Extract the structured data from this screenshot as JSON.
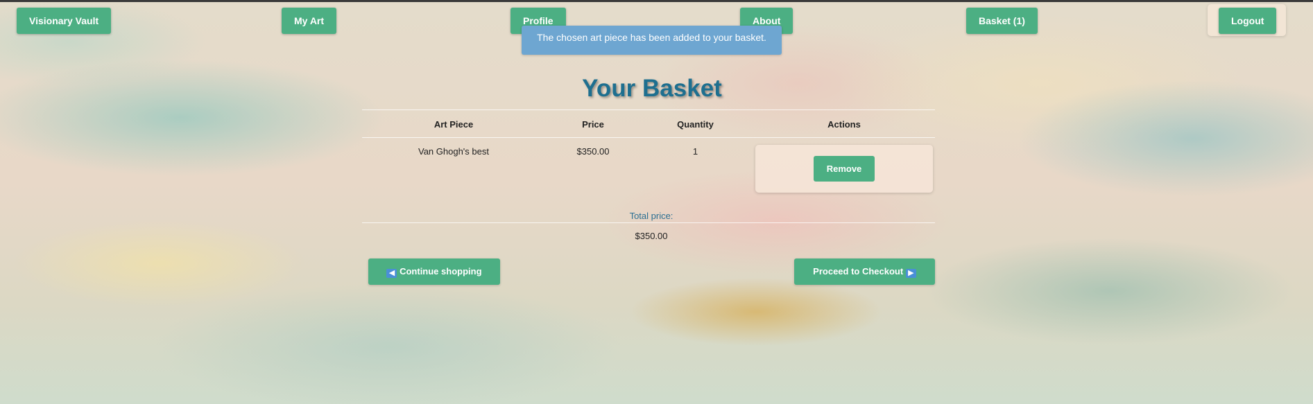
{
  "nav": {
    "brand": "Visionary Vault",
    "my_art": "My Art",
    "profile": "Profile",
    "about": "About",
    "basket": "Basket (1)",
    "logout": "Logout"
  },
  "notification": {
    "message": "The chosen art piece has been added to your basket."
  },
  "basket": {
    "title": "Your Basket",
    "columns": [
      "Art Piece",
      "Price",
      "Quantity",
      "Actions"
    ],
    "items": [
      {
        "art_piece": "Van Ghogh's best",
        "price": "$350.00",
        "quantity": "1",
        "remove_label": "Remove"
      }
    ],
    "total_label": "Total price:",
    "total_value": "$350.00",
    "continue_label": "Continue shopping",
    "continue_icon": "left-arrow-icon",
    "checkout_label": "Proceed to Checkout",
    "checkout_icon": "right-arrow-icon"
  },
  "colors": {
    "accent_green": "#4caf83",
    "notification_blue": "#6ea6d1",
    "title_blue": "#1e6f8f"
  }
}
